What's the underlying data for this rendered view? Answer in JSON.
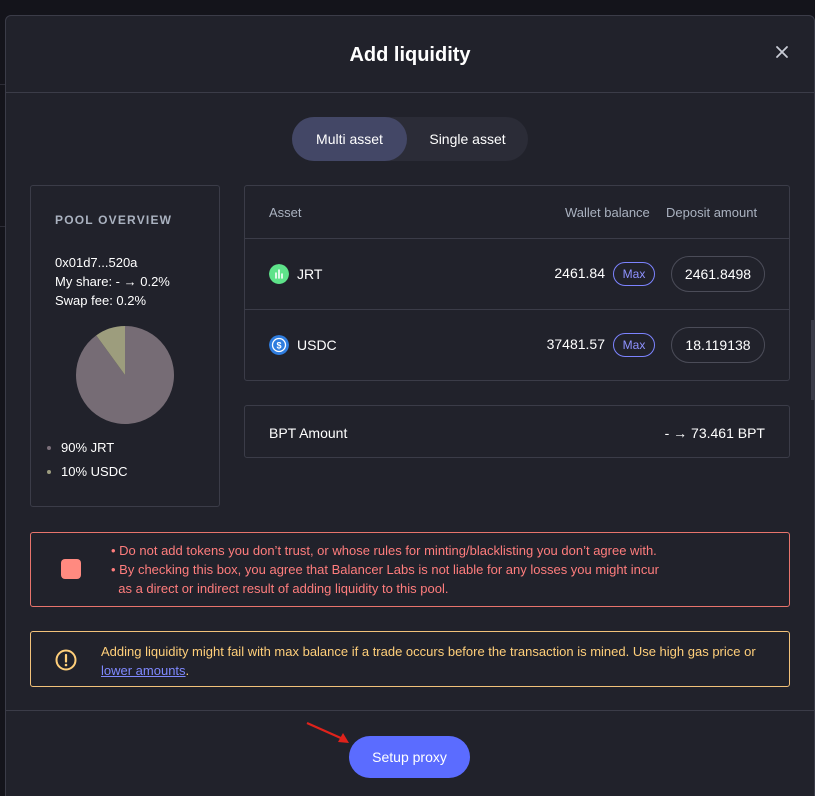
{
  "modal": {
    "title": "Add liquidity"
  },
  "toggle": {
    "multi_label": "Multi asset",
    "single_label": "Single asset",
    "active": "multi"
  },
  "overview": {
    "title": "POOL OVERVIEW",
    "address": "0x01d7...520a",
    "share": "My share: - → 0.2%",
    "swap_fee": "Swap fee: 0.2%",
    "legend": [
      {
        "label": "90% JRT",
        "color": "#7b6f7a"
      },
      {
        "label": "10% USDC",
        "color": "#9c9c7f"
      }
    ]
  },
  "pie_data": {
    "type": "pie",
    "slices": [
      {
        "label": "JRT",
        "value": 90,
        "color": "#766c75"
      },
      {
        "label": "USDC",
        "value": 10,
        "color": "#9d9d7d"
      }
    ]
  },
  "assets": {
    "headers": {
      "asset": "Asset",
      "wallet_balance": "Wallet balance",
      "deposit_amount": "Deposit amount"
    },
    "rows": [
      {
        "token": "JRT",
        "icon": "jrt-token-icon",
        "balance": "2461.84",
        "max_label": "Max",
        "amount": "2461.8498"
      },
      {
        "token": "USDC",
        "icon": "usdc-token-icon",
        "balance": "37481.57",
        "max_label": "Max",
        "amount": "18.119138"
      }
    ]
  },
  "bpt": {
    "label": "BPT Amount",
    "value": "- → 73.461 BPT"
  },
  "warning": {
    "lines": [
      "• Do not add tokens you don’t trust, or whose rules for minting/blacklisting you don’t agree with.",
      "• By checking this box, you agree that Balancer Labs is not liable for any losses you might incur",
      "  as a direct or indirect result of adding liquidity to this pool."
    ],
    "color": "#ff7d7d"
  },
  "info": {
    "text": "Adding liquidity might fail with max balance if a trade occurs before the transaction is mined. Use high gas price or ",
    "link": "lower amounts",
    "suffix": ".",
    "color": "#ffcf7a"
  },
  "footer": {
    "button_label": "Setup proxy",
    "accent": "#5b6cff"
  }
}
